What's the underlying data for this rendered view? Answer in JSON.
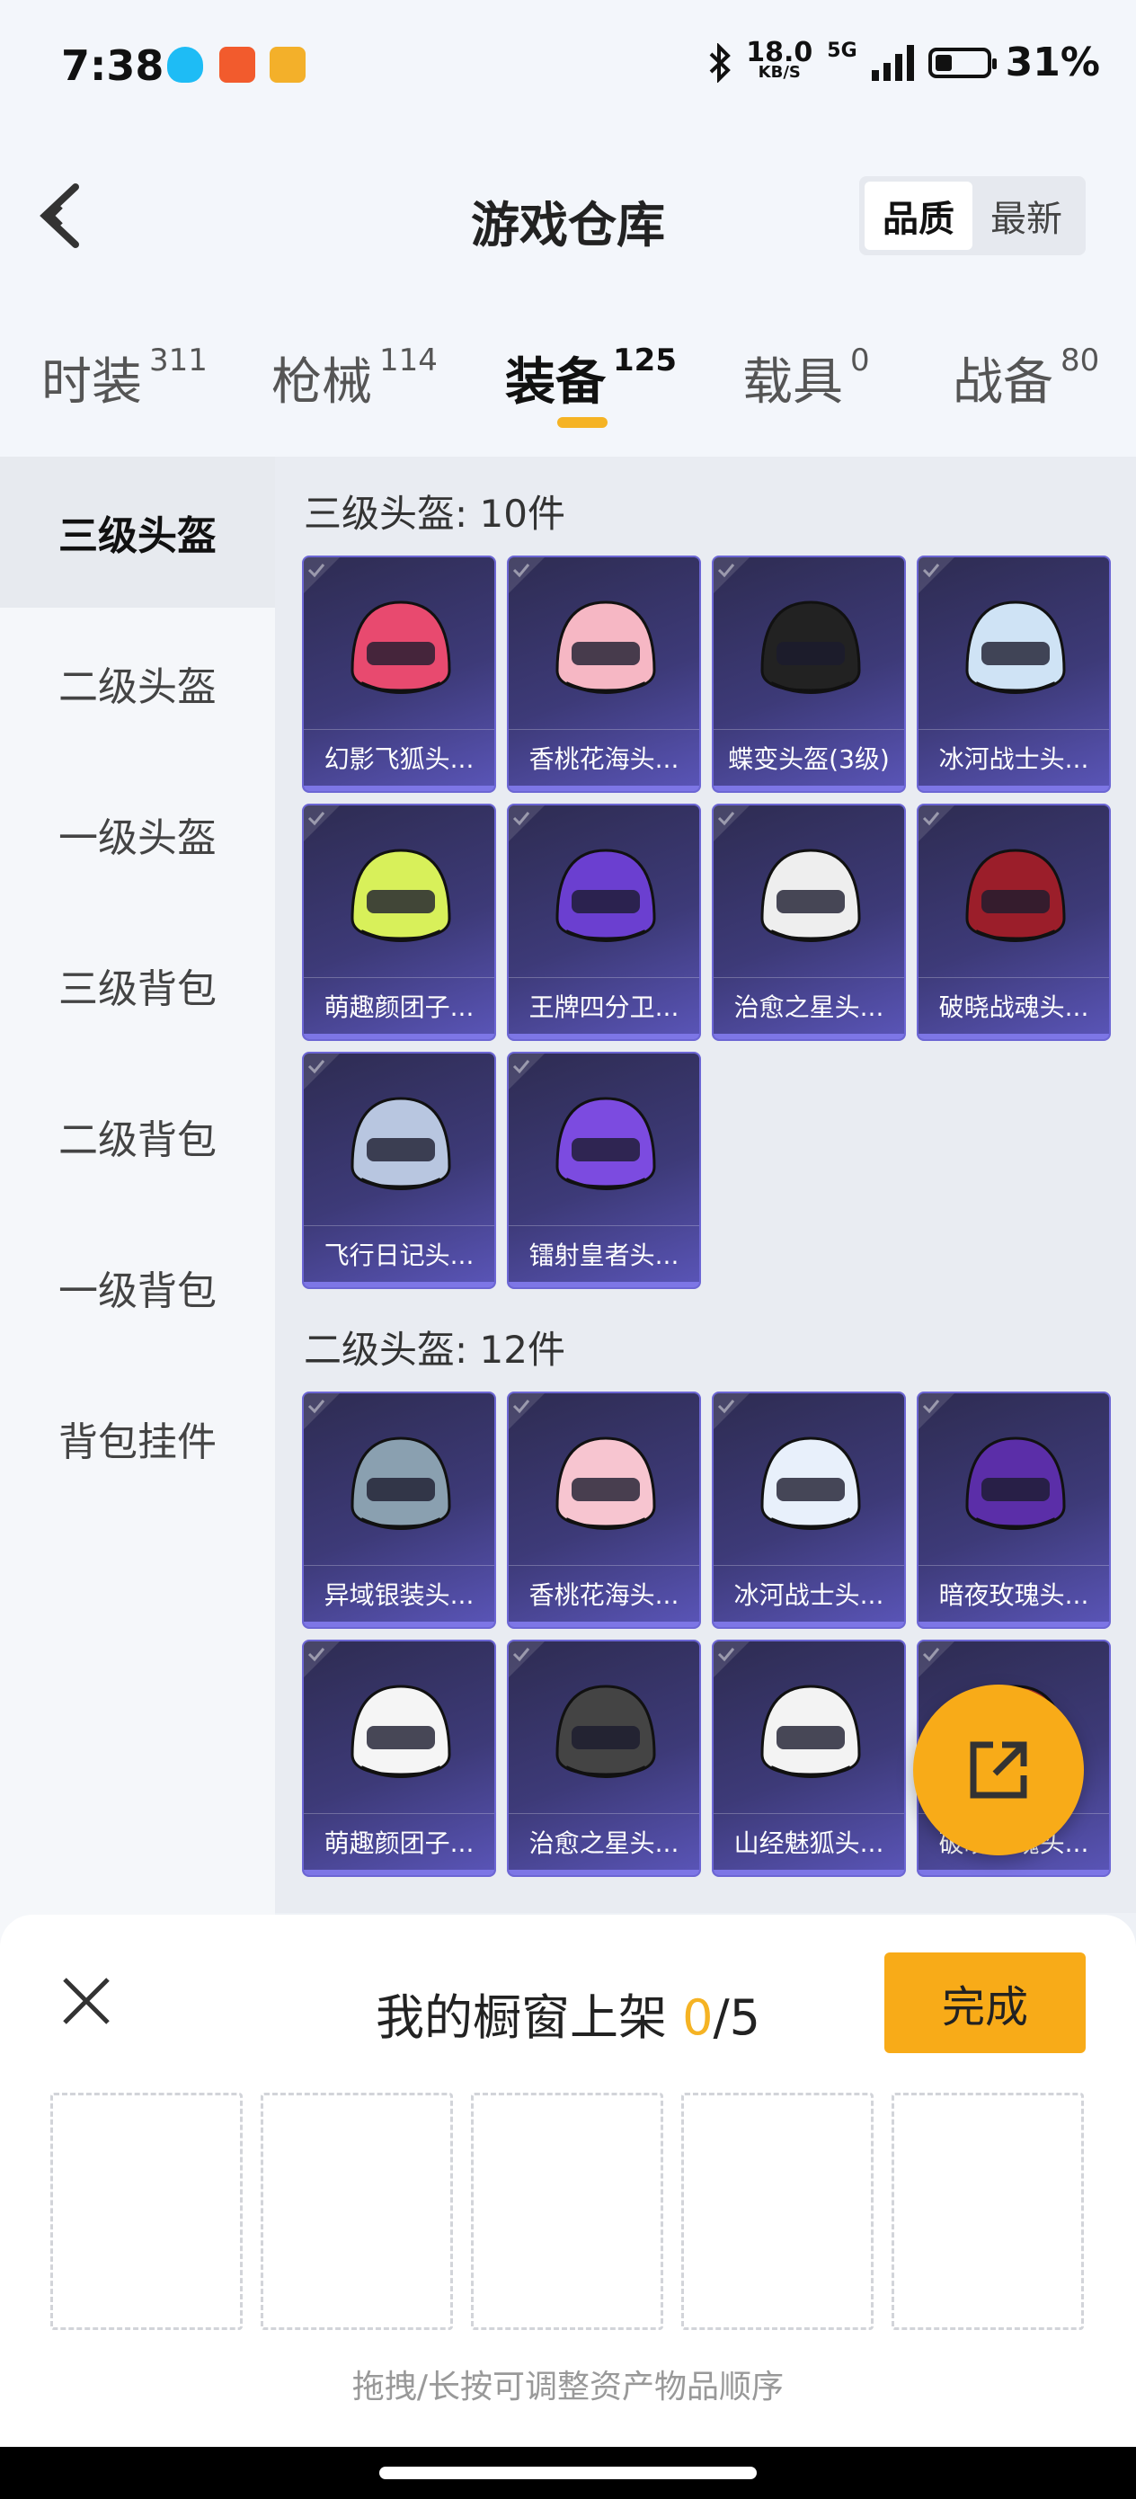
{
  "status_bar": {
    "time": "7:38",
    "net_speed": "18.0",
    "net_unit": "KB/S",
    "network": "5G",
    "battery": "31%",
    "battery_level": 0.31
  },
  "header": {
    "title": "游戏仓库",
    "sort_quality": "品质",
    "sort_latest": "最新"
  },
  "tabs": [
    {
      "label": "时装",
      "count": "311"
    },
    {
      "label": "枪械",
      "count": "114"
    },
    {
      "label": "装备",
      "count": "125"
    },
    {
      "label": "载具",
      "count": "0"
    },
    {
      "label": "战备",
      "count": "80"
    }
  ],
  "sidebar": [
    "三级头盔",
    "二级头盔",
    "一级头盔",
    "三级背包",
    "二级背包",
    "一级背包",
    "背包挂件"
  ],
  "sections": [
    {
      "title": "三级头盔: 10件",
      "items": [
        "幻影飞狐头...",
        "香桃花海头...",
        "蝶变头盔(3级)",
        "冰河战士头...",
        "萌趣颜团子...",
        "王牌四分卫...",
        "治愈之星头...",
        "破晓战魂头...",
        "飞行日记头...",
        "镭射皇者头..."
      ]
    },
    {
      "title": "二级头盔: 12件",
      "items": [
        "异域银装头...",
        "香桃花海头...",
        "冰河战士头...",
        "暗夜玫瑰头...",
        "萌趣颜团子...",
        "治愈之星头...",
        "山经魅狐头...",
        "破晓战魂头..."
      ]
    }
  ],
  "sheet": {
    "title_prefix": "我的橱窗上架 ",
    "count": "0",
    "total": "/5",
    "done": "完成",
    "hint": "拖拽/长按可调整资产物品顺序"
  }
}
